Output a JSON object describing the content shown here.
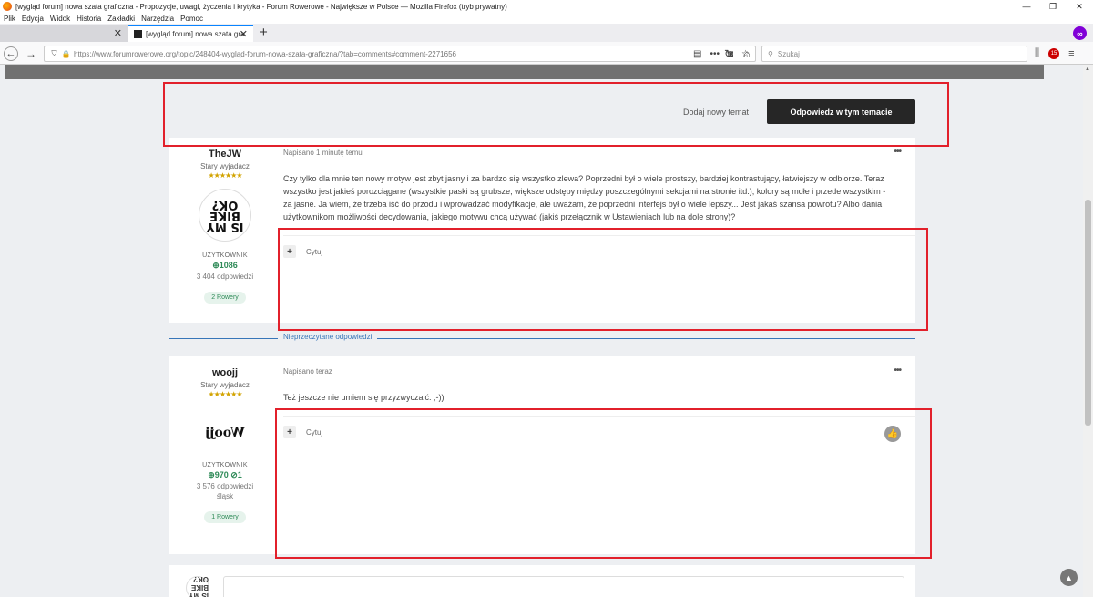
{
  "window": {
    "title": "[wygląd forum] nowa szata graficzna - Propozycje, uwagi, życzenia i krytyka - Forum Rowerowe - Największe w Polsce — Mozilla Firefox (tryb prywatny)",
    "minimize": "—",
    "maximize": "❐",
    "close": "✕"
  },
  "menu": [
    "Plik",
    "Edycja",
    "Widok",
    "Historia",
    "Zakładki",
    "Narzędzia",
    "Pomoc"
  ],
  "tabs": [
    {
      "label": "",
      "close": "✕"
    },
    {
      "label": "[wygląd forum] nowa szata gra",
      "close": "✕"
    }
  ],
  "newtab": "+",
  "private_badge": "∞",
  "nav": {
    "url": "https://www.forumrowerowe.org/topic/248404-wygląd-forum-nowa-szata-graficzna/?tab=comments#comment-2271656",
    "search_placeholder": "Szukaj",
    "addon_badge": "15"
  },
  "actions": {
    "new_topic": "Dodaj nowy temat",
    "reply": "Odpowiedz w tym temacie"
  },
  "posts": [
    {
      "username": "TheJW",
      "rank": "Stary wyjadacz",
      "stars": "★★★★★★",
      "avatar_text": "IS MY BIKE OK?",
      "role": "UŻYTKOWNIK",
      "reputation": "⊕1086",
      "replies": "3 404 odpowiedzi",
      "location": "",
      "bikes": "2 Rowery",
      "meta": "Napisano 1 minutę temu",
      "body": "Czy tylko dla mnie ten nowy motyw jest zbyt jasny i za bardzo się wszystko zlewa? Poprzedni był o wiele prostszy, bardziej kontrastujący, łatwiejszy w odbiorze. Teraz wszystko jest jakieś porozciągane (wszystkie paski są grubsze, większe odstępy między poszczególnymi sekcjami na stronie itd.), kolory są mdłe i przede wszystkim - za jasne. Ja wiem, że trzeba iść do przodu i wprowadzać modyfikacje, ale uważam, że poprzedni interfejs był o wiele lepszy... Jest jakaś szansa powrotu? Albo dania użytkownikom możliwości decydowania, jakiego motywu chcą używać (jakiś przełącznik w Ustawieniach lub na dole strony)?",
      "quote": "Cytuj"
    },
    {
      "username": "woojj",
      "rank": "Stary wyjadacz",
      "stars": "★★★★★★",
      "avatar_text": "Woojj",
      "role": "UŻYTKOWNIK",
      "reputation": "⊕970  ⊘1",
      "replies": "3 576 odpowiedzi",
      "location": "śląsk",
      "bikes": "1 Rowery",
      "meta": "Napisano teraz",
      "body": "Też jeszcze nie umiem się przyzwyczaić. ;-))",
      "quote": "Cytuj"
    }
  ],
  "unread_label": "Nieprzeczytane odpowiedzi",
  "colors": {
    "highlight_box": "#e2202b",
    "accent": "#3775b8",
    "reply_button": "#262626",
    "reputation": "#2e8a57"
  }
}
